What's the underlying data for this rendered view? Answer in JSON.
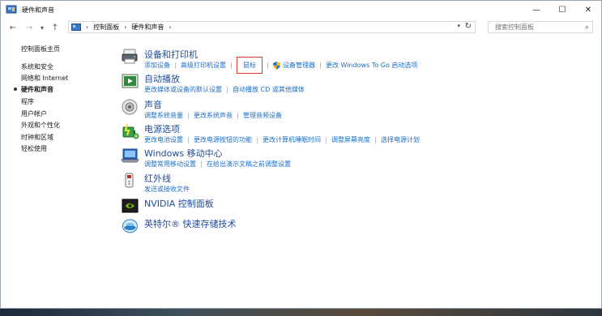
{
  "window": {
    "title": "硬件和声音"
  },
  "window_controls": {
    "minimize": "—",
    "maximize": "☐",
    "close": "✕"
  },
  "nav": {
    "back": "←",
    "forward": "→",
    "recent": "▾",
    "up": "↑"
  },
  "address": {
    "sep": "›",
    "crumbs": [
      "控制面板",
      "硬件和声音"
    ],
    "dropdown": "▾",
    "refresh": "↻"
  },
  "search": {
    "placeholder": "搜索控制面板",
    "icon": "⌕"
  },
  "sidebar": {
    "home": "控制面板主页",
    "items": [
      {
        "label": "系统和安全"
      },
      {
        "label": "网络和 Internet"
      },
      {
        "label": "硬件和声音",
        "current": true
      },
      {
        "label": "程序"
      },
      {
        "label": "用户帐户"
      },
      {
        "label": "外观和个性化"
      },
      {
        "label": "时钟和区域"
      },
      {
        "label": "轻松使用"
      }
    ]
  },
  "categories": [
    {
      "title": "设备和打印机",
      "icon": "printer-icon",
      "links": [
        "添加设备",
        "高级打印机设置",
        "鼠标",
        "设备管理器",
        "更改 Windows To Go 启动选项"
      ],
      "highlighted": "鼠标"
    },
    {
      "title": "自动播放",
      "icon": "autoplay-icon",
      "links": [
        "更改媒体或设备的默认设置",
        "自动播放 CD 或其他媒体"
      ]
    },
    {
      "title": "声音",
      "icon": "speaker-icon",
      "links": [
        "调整系统音量",
        "更改系统声音",
        "管理音频设备"
      ]
    },
    {
      "title": "电源选项",
      "icon": "power-options-icon",
      "links": [
        "更改电池设置",
        "更改电源按钮的功能",
        "更改计算机睡眠时间",
        "调整屏幕亮度",
        "选择电源计划"
      ]
    },
    {
      "title": "Windows 移动中心",
      "icon": "mobility-center-icon",
      "links": [
        "调整常用移动设置",
        "在给出演示文稿之前调整设置"
      ]
    },
    {
      "title": "红外线",
      "icon": "infrared-icon",
      "links": [
        "发送或接收文件"
      ]
    },
    {
      "title": "NVIDIA 控制面板",
      "icon": "nvidia-icon",
      "links": []
    },
    {
      "title": "英特尔® 快速存储技术",
      "icon": "intel-rst-icon",
      "links": []
    }
  ],
  "colors": {
    "link": "#1b6fc6",
    "heading": "#1e4a9b",
    "highlight_border": "#d9392b"
  }
}
